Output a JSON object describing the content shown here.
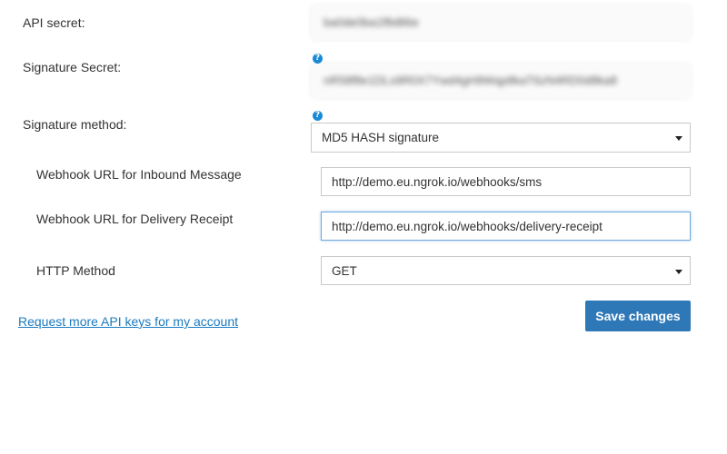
{
  "fields": {
    "api_secret": {
      "label": "API secret:",
      "value": "ba0de0ba1f8d86e"
    },
    "signature_secret": {
      "label": "Signature Secret:",
      "value": "nR58f8e1DLs9R0X7Ywd4gH9Wqp8kaT6zN4RD0d8ka8",
      "help": "?"
    },
    "signature_method": {
      "label": "Signature method:",
      "value": "MD5 HASH signature",
      "help": "?"
    },
    "webhook_inbound": {
      "label": "Webhook URL for Inbound Message",
      "value": "http://demo.eu.ngrok.io/webhooks/sms"
    },
    "webhook_delivery": {
      "label": "Webhook URL for Delivery Receipt",
      "value": "http://demo.eu.ngrok.io/webhooks/delivery-receipt"
    },
    "http_method": {
      "label": "HTTP Method",
      "value": "GET"
    }
  },
  "actions": {
    "request_link": "Request more API keys for my account",
    "save_label": "Save changes"
  }
}
